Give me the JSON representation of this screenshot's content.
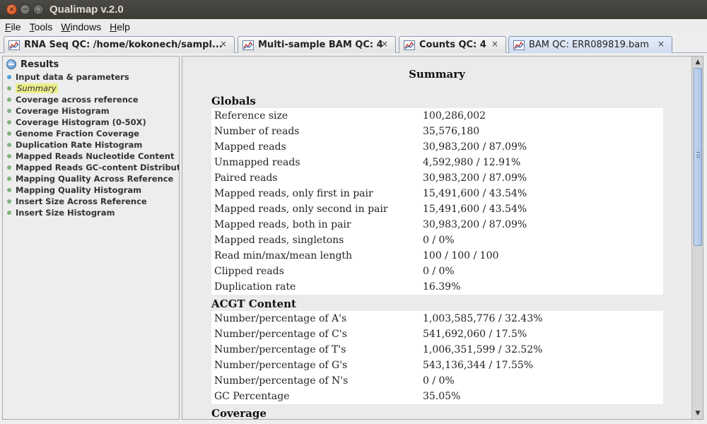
{
  "window": {
    "title": "Qualimap v.2.0"
  },
  "menu": [
    {
      "label": "File",
      "mnemonic": "F",
      "rest": "ile"
    },
    {
      "label": "Tools",
      "mnemonic": "T",
      "rest": "ools"
    },
    {
      "label": "Windows",
      "mnemonic": "W",
      "rest": "indows"
    },
    {
      "label": "Help",
      "mnemonic": "H",
      "rest": "elp"
    }
  ],
  "tabs": [
    {
      "label": "RNA Seq QC: /home/kokonech/sampl...",
      "icon": "chart-icon",
      "close": "×"
    },
    {
      "label": "Multi-sample BAM QC: 4",
      "icon": "chart-icon",
      "close": "×"
    },
    {
      "label": "Counts QC: 4",
      "icon": "chart-icon",
      "close": "×"
    },
    {
      "label": "BAM QC: ERR089819.bam",
      "icon": "chart-icon",
      "close": "×",
      "active": true
    }
  ],
  "sidebar": {
    "root_label": "Results",
    "items": [
      {
        "label": "Input data & parameters",
        "bullet": "blue"
      },
      {
        "label": "Summary",
        "bullet": "green",
        "selected": true
      },
      {
        "label": "Coverage across reference",
        "bullet": "green"
      },
      {
        "label": "Coverage Histogram",
        "bullet": "green"
      },
      {
        "label": "Coverage Histogram (0-50X)",
        "bullet": "green"
      },
      {
        "label": "Genome Fraction Coverage",
        "bullet": "green"
      },
      {
        "label": "Duplication Rate Histogram",
        "bullet": "green"
      },
      {
        "label": "Mapped Reads Nucleotide Content",
        "bullet": "green"
      },
      {
        "label": "Mapped Reads GC-content Distributi",
        "bullet": "green"
      },
      {
        "label": "Mapping Quality Across Reference",
        "bullet": "green"
      },
      {
        "label": "Mapping Quality Histogram",
        "bullet": "green"
      },
      {
        "label": "Insert Size Across Reference",
        "bullet": "green"
      },
      {
        "label": "Insert Size Histogram",
        "bullet": "green"
      }
    ]
  },
  "summary": {
    "title": "Summary",
    "globals": {
      "title": "Globals",
      "rows": [
        {
          "key": "Reference size",
          "value": "100,286,002"
        },
        {
          "key": "Number of reads",
          "value": "35,576,180"
        },
        {
          "key": "Mapped reads",
          "value": "30,983,200 / 87.09%"
        },
        {
          "key": "Unmapped reads",
          "value": "4,592,980 / 12.91%"
        },
        {
          "key": "Paired reads",
          "value": "30,983,200 / 87.09%"
        },
        {
          "key": "Mapped reads, only first in pair",
          "value": "15,491,600 / 43.54%"
        },
        {
          "key": "Mapped reads, only second in pair",
          "value": "15,491,600 / 43.54%"
        },
        {
          "key": "Mapped reads, both in pair",
          "value": "30,983,200 / 87.09%"
        },
        {
          "key": "Mapped reads, singletons",
          "value": "0 / 0%"
        },
        {
          "key": "Read min/max/mean length",
          "value": "100 / 100 / 100"
        },
        {
          "key": "Clipped reads",
          "value": "0 / 0%"
        },
        {
          "key": "Duplication rate",
          "value": "16.39%"
        }
      ]
    },
    "acgt": {
      "title": "ACGT Content",
      "rows": [
        {
          "key": "Number/percentage of A's",
          "value": "1,003,585,776 / 32.43%"
        },
        {
          "key": "Number/percentage of C's",
          "value": "541,692,060 / 17.5%"
        },
        {
          "key": "Number/percentage of T's",
          "value": "1,006,351,599 / 32.52%"
        },
        {
          "key": "Number/percentage of G's",
          "value": "543,136,344 / 17.55%"
        },
        {
          "key": "Number/percentage of N's",
          "value": "0 / 0%"
        },
        {
          "key": "GC Percentage",
          "value": "35.05%"
        }
      ]
    },
    "coverage": {
      "title": "Coverage"
    }
  },
  "colors": {
    "titlebar": "#3c3b37",
    "active_tab": "#cfdcf0",
    "selected_item": "#eaee8a",
    "table_bg": "#ffffff"
  }
}
